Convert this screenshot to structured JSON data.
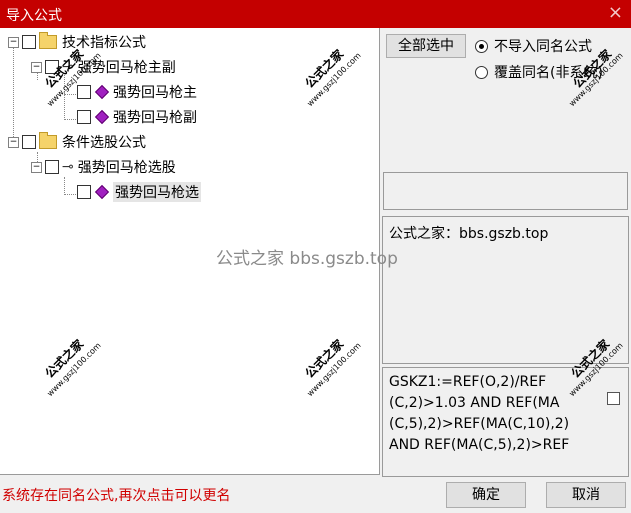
{
  "window": {
    "title": "导入公式",
    "close_icon": "×"
  },
  "tree": {
    "root1": {
      "label": "技术指标公式"
    },
    "child1": {
      "label": "强势回马枪主副"
    },
    "leaf1": {
      "label": "强势回马枪主"
    },
    "leaf2": {
      "label": "强势回马枪副"
    },
    "root2": {
      "label": "条件选股公式"
    },
    "child2": {
      "label": "强势回马枪选股"
    },
    "leaf3": {
      "label": "强势回马枪选"
    }
  },
  "controls": {
    "select_all": "全部选中",
    "radio_no_import": "不导入同名公式",
    "radio_overwrite": "覆盖同名(非系统)"
  },
  "info": {
    "text": "公式之家：bbs.gszb.top"
  },
  "code": {
    "text": "GSKZ1:=REF(O,2)/REF (C,2)>1.03 AND REF(MA (C,5),2)>REF(MA(C,10),2) AND REF(MA(C,5),2)>REF"
  },
  "footer": {
    "status": "系统存在同名公式,再次点击可以更名",
    "ok": "确定",
    "cancel": "取消"
  },
  "watermark": {
    "center": "公式之家 bbs.gszb.top",
    "stamp": "公式之家",
    "url": "www.gszj100.com"
  }
}
